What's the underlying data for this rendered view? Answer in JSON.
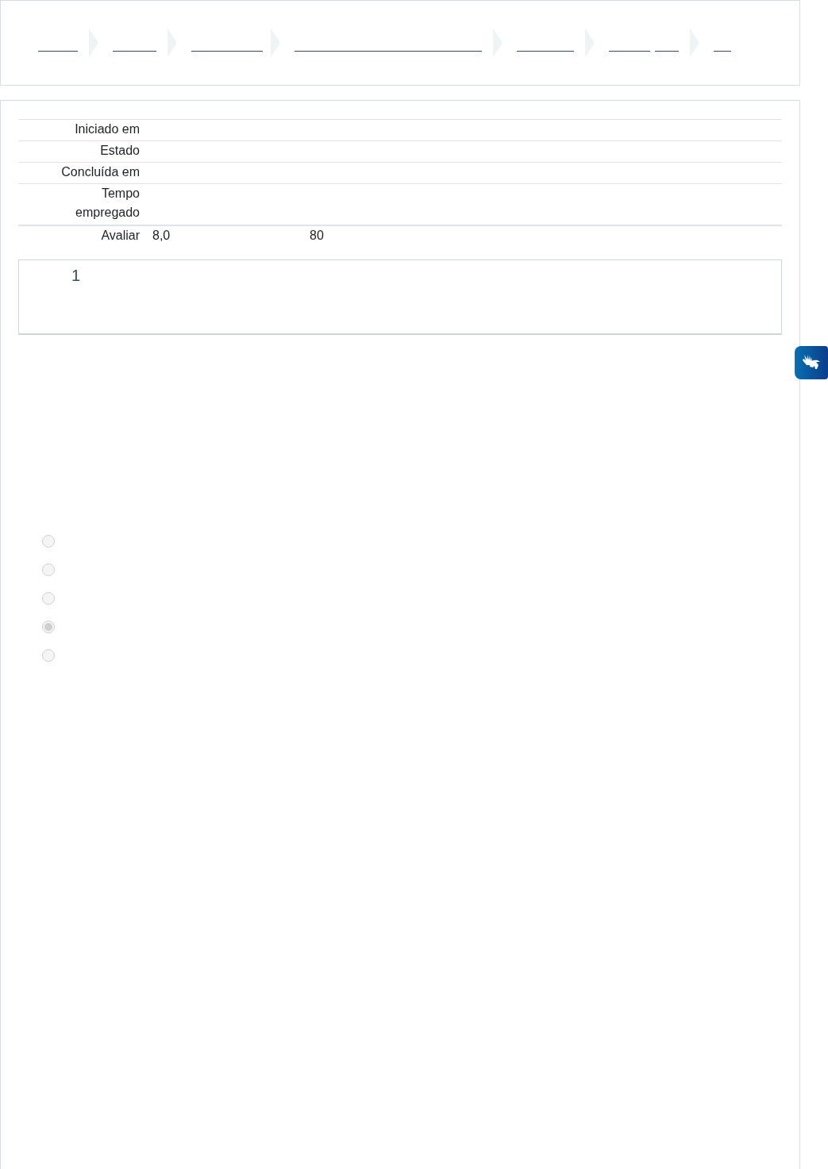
{
  "summary": {
    "rows": [
      {
        "label": "Iniciado em"
      },
      {
        "label": "Estado"
      },
      {
        "label": "Concluída em"
      },
      {
        "label": "Tempo empregado"
      },
      {
        "label": "Avaliar",
        "value": "8,0",
        "extra": "80"
      }
    ]
  },
  "question": {
    "number": "1"
  },
  "options": [
    {
      "selected": false
    },
    {
      "selected": false
    },
    {
      "selected": false
    },
    {
      "selected": true
    },
    {
      "selected": false
    }
  ]
}
